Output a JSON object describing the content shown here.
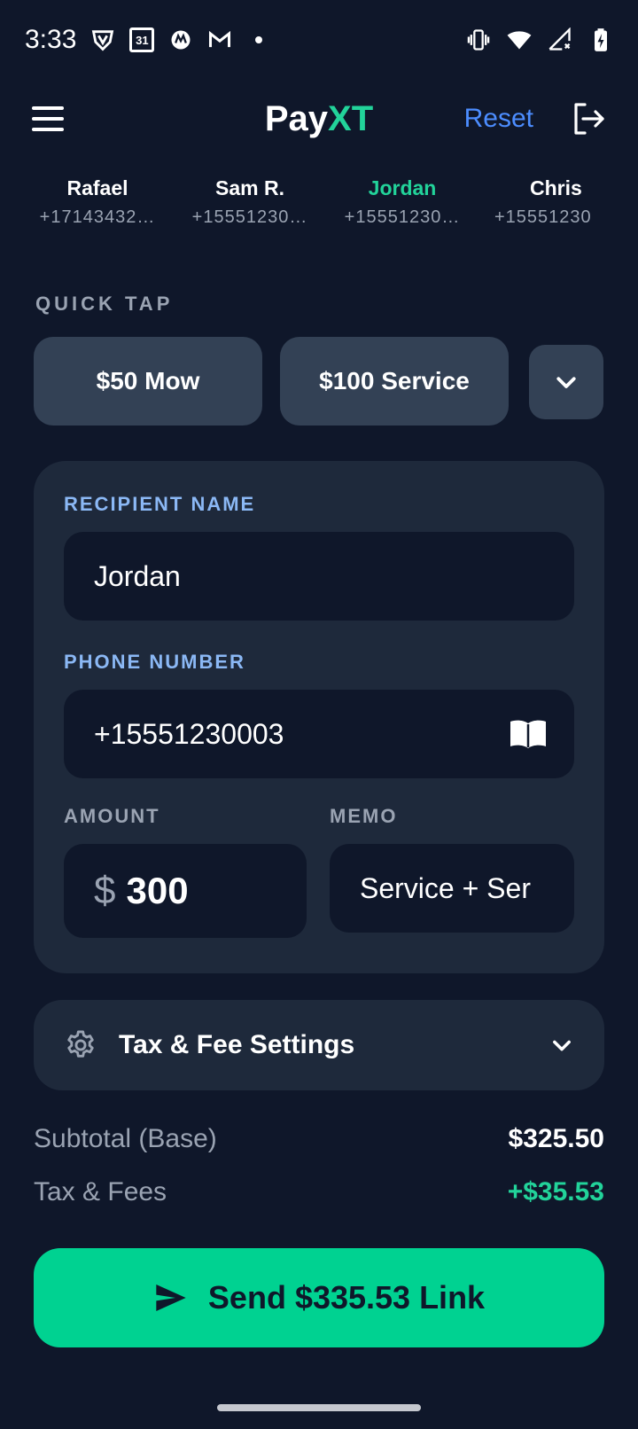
{
  "status_bar": {
    "time": "3:33",
    "calendar_day": "31",
    "left_icons": [
      "shield-v-icon",
      "calendar-icon",
      "motorola-icon",
      "gmail-icon",
      "dot-icon"
    ],
    "right_icons": [
      "vibrate-icon",
      "wifi-icon",
      "cell-signal-icon",
      "battery-charging-icon"
    ]
  },
  "header": {
    "brand_main": "Pay",
    "brand_accent": "XT",
    "reset_label": "Reset",
    "menu_icon": "hamburger-icon",
    "logout_icon": "logout-icon"
  },
  "contacts": [
    {
      "name": "Rafael",
      "phone": "+17143432…",
      "active": false
    },
    {
      "name": "Sam R.",
      "phone": "+15551230…",
      "active": false
    },
    {
      "name": "Jordan",
      "phone": "+15551230…",
      "active": true
    },
    {
      "name": "Chris",
      "phone": "+15551230",
      "active": false
    }
  ],
  "quick_tap": {
    "title": "QUICK TAP",
    "buttons": [
      "$50 Mow",
      "$100 Service"
    ],
    "more_icon": "chevron-down-icon"
  },
  "form": {
    "recipient_label": "RECIPIENT NAME",
    "recipient_value": "Jordan",
    "phone_label": "PHONE NUMBER",
    "phone_value": "+15551230003",
    "phone_icon": "contact-book-icon",
    "amount_label": "AMOUNT",
    "amount_currency": "$",
    "amount_value": "300",
    "memo_label": "MEMO",
    "memo_value": "Service + Ser"
  },
  "tax_settings": {
    "title": "Tax & Fee Settings",
    "icon": "gear-icon",
    "expand_icon": "chevron-down-icon"
  },
  "summary": {
    "subtotal_label": "Subtotal (Base)",
    "subtotal_value": "$325.50",
    "tax_label": "Tax & Fees",
    "tax_value": "+$35.53"
  },
  "send": {
    "label": "Send $335.53 Link",
    "icon": "send-icon"
  },
  "colors": {
    "background": "#0f172a",
    "card": "#1e293b",
    "accent_green": "#22d39a",
    "button_green": "#00d291",
    "link_blue": "#4c8dff",
    "label_blue": "#8bb8f5"
  }
}
